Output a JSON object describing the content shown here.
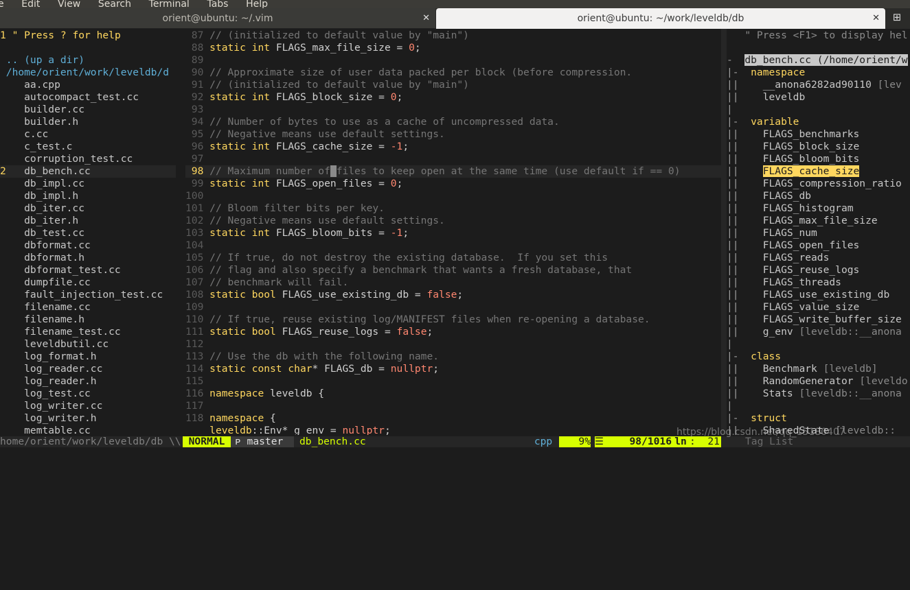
{
  "menubar": [
    "e",
    "Edit",
    "View",
    "Search",
    "Terminal",
    "Tabs",
    "Help"
  ],
  "tabs": [
    {
      "title": "orient@ubuntu: ~/.vim",
      "active": false
    },
    {
      "title": "orient@ubuntu: ~/work/leveldb/db",
      "active": true
    }
  ],
  "tree": {
    "help_num": "1",
    "help": "\" Press ? for help",
    "updir": ".. (up a dir)",
    "root": "/home/orient/work/leveldb/d",
    "cur_num": "2",
    "files": [
      "aa.cpp",
      "autocompact_test.cc",
      "builder.cc",
      "builder.h",
      "c.cc",
      "c_test.c",
      "corruption_test.cc",
      "db_bench.cc",
      "db_impl.cc",
      "db_impl.h",
      "db_iter.cc",
      "db_iter.h",
      "db_test.cc",
      "dbformat.cc",
      "dbformat.h",
      "dbformat_test.cc",
      "dumpfile.cc",
      "fault_injection_test.cc",
      "filename.cc",
      "filename.h",
      "filename_test.cc",
      "leveldbutil.cc",
      "log_format.h",
      "log_reader.cc",
      "log_reader.h",
      "log_test.cc",
      "log_writer.cc",
      "log_writer.h",
      "memtable.cc"
    ]
  },
  "editor": {
    "lines": [
      {
        "n": "87",
        "segs": [
          [
            "c",
            "// (initialized to default value by \"main\")"
          ]
        ]
      },
      {
        "n": "88",
        "segs": [
          [
            "k",
            "static int"
          ],
          [
            "i",
            " FLAGS_max_file_size = "
          ],
          [
            "v",
            "0"
          ],
          [
            "i",
            ";"
          ]
        ]
      },
      {
        "n": "89",
        "segs": []
      },
      {
        "n": "90",
        "segs": [
          [
            "c",
            "// Approximate size of user data packed per block (before compression."
          ]
        ]
      },
      {
        "n": "91",
        "segs": [
          [
            "c",
            "// (initialized to default value by \"main\")"
          ]
        ]
      },
      {
        "n": "92",
        "segs": [
          [
            "k",
            "static int"
          ],
          [
            "i",
            " FLAGS_block_size = "
          ],
          [
            "v",
            "0"
          ],
          [
            "i",
            ";"
          ]
        ]
      },
      {
        "n": "93",
        "segs": []
      },
      {
        "n": "94",
        "segs": [
          [
            "c",
            "// Number of bytes to use as a cache of uncompressed data."
          ]
        ]
      },
      {
        "n": "95",
        "segs": [
          [
            "c",
            "// Negative means use default settings."
          ]
        ]
      },
      {
        "n": "96",
        "segs": [
          [
            "k",
            "static int"
          ],
          [
            "i",
            " FLAGS_cache_size = "
          ],
          [
            "v",
            "-1"
          ],
          [
            "i",
            ";"
          ]
        ]
      },
      {
        "n": "97",
        "segs": []
      },
      {
        "n": "98",
        "cur": true,
        "segs": [
          [
            "c",
            "// Maximum number of"
          ],
          [
            "cur",
            " "
          ],
          [
            "c",
            "files to keep open at the same time (use default if == 0)"
          ]
        ]
      },
      {
        "n": "99",
        "segs": [
          [
            "k",
            "static int"
          ],
          [
            "i",
            " FLAGS_open_files = "
          ],
          [
            "v",
            "0"
          ],
          [
            "i",
            ";"
          ]
        ]
      },
      {
        "n": "100",
        "segs": []
      },
      {
        "n": "101",
        "segs": [
          [
            "c",
            "// Bloom filter bits per key."
          ]
        ]
      },
      {
        "n": "102",
        "segs": [
          [
            "c",
            "// Negative means use default settings."
          ]
        ]
      },
      {
        "n": "103",
        "segs": [
          [
            "k",
            "static int"
          ],
          [
            "i",
            " FLAGS_bloom_bits = "
          ],
          [
            "v",
            "-1"
          ],
          [
            "i",
            ";"
          ]
        ]
      },
      {
        "n": "104",
        "segs": []
      },
      {
        "n": "105",
        "segs": [
          [
            "c",
            "// If true, do not destroy the existing database.  If you set this"
          ]
        ]
      },
      {
        "n": "106",
        "segs": [
          [
            "c",
            "// flag and also specify a benchmark that wants a fresh database, that"
          ]
        ]
      },
      {
        "n": "107",
        "segs": [
          [
            "c",
            "// benchmark will fail."
          ]
        ]
      },
      {
        "n": "108",
        "segs": [
          [
            "k",
            "static bool"
          ],
          [
            "i",
            " FLAGS_use_existing_db = "
          ],
          [
            "v",
            "false"
          ],
          [
            "i",
            ";"
          ]
        ]
      },
      {
        "n": "109",
        "segs": []
      },
      {
        "n": "110",
        "segs": [
          [
            "c",
            "// If true, reuse existing log/MANIFEST files when re-opening a database."
          ]
        ]
      },
      {
        "n": "111",
        "segs": [
          [
            "k",
            "static bool"
          ],
          [
            "i",
            " FLAGS_reuse_logs = "
          ],
          [
            "v",
            "false"
          ],
          [
            "i",
            ";"
          ]
        ]
      },
      {
        "n": "112",
        "segs": []
      },
      {
        "n": "113",
        "segs": [
          [
            "c",
            "// Use the db with the following name."
          ]
        ]
      },
      {
        "n": "114",
        "segs": [
          [
            "k",
            "static const char"
          ],
          [
            "i",
            "* FLAGS_db = "
          ],
          [
            "v",
            "nullptr"
          ],
          [
            "i",
            ";"
          ]
        ]
      },
      {
        "n": "115",
        "segs": []
      },
      {
        "n": "116",
        "segs": [
          [
            "k",
            "namespace"
          ],
          [
            "i",
            " leveldb {"
          ]
        ]
      },
      {
        "n": "117",
        "segs": []
      },
      {
        "n": "118",
        "segs": [
          [
            "k",
            "namespace"
          ],
          [
            "i",
            " {"
          ]
        ]
      },
      {
        "n": "",
        "segs": [
          [
            "k",
            "leveldb"
          ],
          [
            "i",
            "::Env* g_env = "
          ],
          [
            "v",
            "nullptr"
          ],
          [
            "i",
            ";"
          ]
        ]
      }
    ]
  },
  "tagbar": {
    "help": "\" Press <F1> to display hel",
    "file": "db_bench.cc (/home/orient/w",
    "file_fold": "-",
    "rows": [
      {
        "fold": "|-",
        "text": "  namespace",
        "kind": "hdr"
      },
      {
        "fold": "||",
        "text": "    __anona6282ad90110 ",
        "scope": "[lev",
        "kind": "item"
      },
      {
        "fold": "||",
        "text": "    leveldb",
        "kind": "item"
      },
      {
        "fold": "|",
        "text": "",
        "kind": "blank"
      },
      {
        "fold": "|-",
        "text": "  variable",
        "kind": "hdr"
      },
      {
        "fold": "||",
        "text": "    FLAGS_benchmarks",
        "kind": "item"
      },
      {
        "fold": "||",
        "text": "    FLAGS_block_size",
        "kind": "item"
      },
      {
        "fold": "||",
        "text": "    FLAGS_bloom_bits",
        "kind": "item"
      },
      {
        "fold": "||",
        "text": "    ",
        "hl": "FLAGS_cache_size",
        "kind": "hl"
      },
      {
        "fold": "||",
        "text": "    FLAGS_compression_ratio",
        "kind": "item"
      },
      {
        "fold": "||",
        "text": "    FLAGS_db",
        "kind": "item"
      },
      {
        "fold": "||",
        "text": "    FLAGS_histogram",
        "kind": "item"
      },
      {
        "fold": "||",
        "text": "    FLAGS_max_file_size",
        "kind": "item"
      },
      {
        "fold": "||",
        "text": "    FLAGS_num",
        "kind": "item"
      },
      {
        "fold": "||",
        "text": "    FLAGS_open_files",
        "kind": "item"
      },
      {
        "fold": "||",
        "text": "    FLAGS_reads",
        "kind": "item"
      },
      {
        "fold": "||",
        "text": "    FLAGS_reuse_logs",
        "kind": "item"
      },
      {
        "fold": "||",
        "text": "    FLAGS_threads",
        "kind": "item"
      },
      {
        "fold": "||",
        "text": "    FLAGS_use_existing_db",
        "kind": "item"
      },
      {
        "fold": "||",
        "text": "    FLAGS_value_size",
        "kind": "item"
      },
      {
        "fold": "||",
        "text": "    FLAGS_write_buffer_size",
        "kind": "item"
      },
      {
        "fold": "||",
        "text": "    g_env ",
        "scope": "[leveldb::__anona",
        "kind": "item"
      },
      {
        "fold": "|",
        "text": "",
        "kind": "blank"
      },
      {
        "fold": "|-",
        "text": "  class",
        "kind": "hdr"
      },
      {
        "fold": "||",
        "text": "    Benchmark ",
        "scope": "[leveldb]",
        "kind": "item"
      },
      {
        "fold": "||",
        "text": "    RandomGenerator ",
        "scope": "[leveldo",
        "kind": "item"
      },
      {
        "fold": "||",
        "text": "    Stats ",
        "scope": "[leveldb::__anona",
        "kind": "item"
      },
      {
        "fold": "|",
        "text": "",
        "kind": "blank"
      },
      {
        "fold": "|-",
        "text": "  struct",
        "kind": "hdr"
      },
      {
        "fold": "||",
        "text": "    SharedState ",
        "scope": "[leveldb::_",
        "kind": "item"
      }
    ]
  },
  "status": {
    "tree_path": "home/orient/work/leveldb/db",
    "sep": "\\\\",
    "mode": "NORMAL",
    "branch": "ᴘ master",
    "file": "db_bench.cc",
    "filetype": "cpp",
    "percent": "9%",
    "menu_glyph": "☰",
    "position": "98/1016",
    "ln": "ln",
    "col": ":  21",
    "tag_label": "Tag List"
  },
  "watermark": "https://blog.csdn.net/qq_15180407",
  "colors": {
    "accent": "#ffd75f",
    "mode_bg": "#d7ff00",
    "comment": "#767676",
    "keyword": "#ffd75f",
    "constant": "#ff8770",
    "dir": "#5fafd7"
  }
}
